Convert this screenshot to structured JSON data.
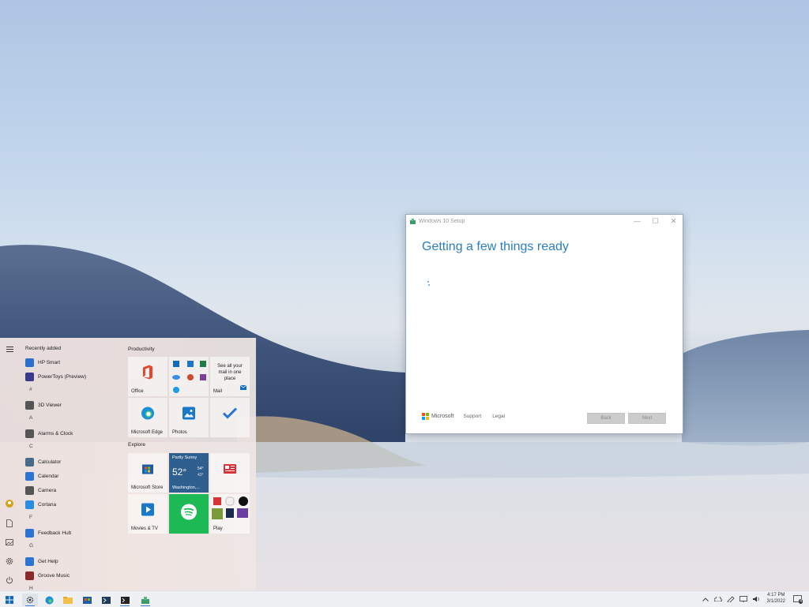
{
  "setup_window": {
    "title": "Windows 10 Setup",
    "heading": "Getting a few things ready",
    "brand": "Microsoft",
    "links": [
      "Support",
      "Legal"
    ],
    "back_label": "Back",
    "next_label": "Next",
    "controls": {
      "minimize": "—",
      "maximize": "☐",
      "close": "✕"
    }
  },
  "start_menu": {
    "recently_added_label": "Recently added",
    "apps": [
      {
        "label": "HP Smart",
        "icon": "hp-smart-icon",
        "color": "#2a6fc9"
      },
      {
        "label": "PowerToys (Preview)",
        "icon": "powertoys-icon",
        "color": "#3a3a8c"
      },
      {
        "letter": "#"
      },
      {
        "label": "3D Viewer",
        "icon": "cube-icon",
        "color": "#555555"
      },
      {
        "letter": "A"
      },
      {
        "label": "Alarms & Clock",
        "icon": "clock-icon",
        "color": "#555555"
      },
      {
        "letter": "C"
      },
      {
        "label": "Calculator",
        "icon": "calculator-icon",
        "color": "#4a6a8a"
      },
      {
        "label": "Calendar",
        "icon": "calendar-icon",
        "color": "#2b74d0"
      },
      {
        "label": "Camera",
        "icon": "camera-icon",
        "color": "#555555"
      },
      {
        "label": "Cortana",
        "icon": "cortana-icon",
        "color": "#2a8ee0"
      },
      {
        "letter": "F"
      },
      {
        "label": "Feedback Hub",
        "icon": "feedback-icon",
        "color": "#2b74d0"
      },
      {
        "letter": "G"
      },
      {
        "label": "Get Help",
        "icon": "help-icon",
        "color": "#2b74d0"
      },
      {
        "label": "Groove Music",
        "icon": "music-icon",
        "color": "#8a2a2a"
      },
      {
        "letter": "H"
      }
    ],
    "groups": [
      "Productivity",
      "Explore"
    ],
    "tiles": {
      "office": "Office",
      "mail_promo": "See all your mail in one place",
      "mail": "Mail",
      "edge": "Microsoft Edge",
      "photos": "Photos",
      "store": "Microsoft Store",
      "weather_cond": "Partly Sunny",
      "weather_temp": "52°",
      "weather_hi": "54°",
      "weather_lo": "43°",
      "weather_loc": "Washington,...",
      "movies": "Movies & TV",
      "play": "Play"
    }
  },
  "taskbar": {
    "time": "4:17 PM",
    "date": "3/1/2022",
    "notification_count": "4"
  },
  "colors": {
    "accent": "#2b7ec1",
    "taskbar": "#eef0f3"
  }
}
